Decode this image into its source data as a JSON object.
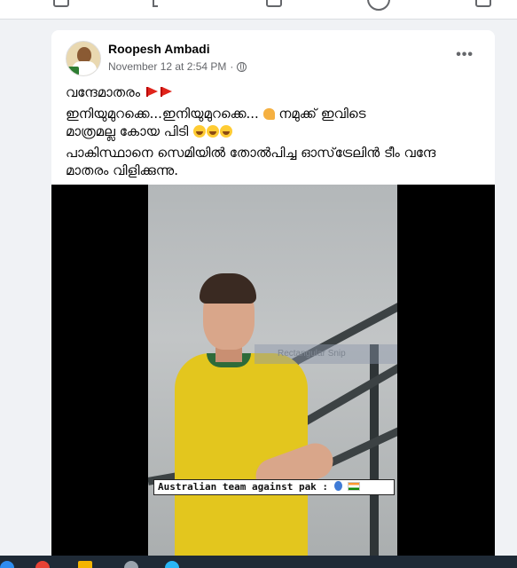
{
  "post": {
    "author": "Roopesh Ambadi",
    "timestamp": "November 12 at 2:54 PM",
    "separator": "·",
    "more_label": "•••",
    "line1": "വന്ദേമാതരം",
    "line2": "ഇനിയുമുറക്കെ...ഇനിയുമുറക്കെ...",
    "line2b": "നമുക്ക് ഇവിടെ",
    "line3": "മാത്രമല്ല കോയ പിടി",
    "line4": "പാകിസ്ഥാനെ സെമിയിൽ തോൽപിച്ച ഓസ്‌ട്രേലിൻ ടീം വന്ദേ മാതരം വിളിക്കുന്നു."
  },
  "media": {
    "snip_label": "Rectangular Snip",
    "caption": "Australian team against pak :"
  },
  "colors": {
    "accent": "#1877f2",
    "shirt": "#e3c61e",
    "background": "#f0f2f5"
  },
  "icons": [
    "globe-icon",
    "more-icon",
    "flag-icon",
    "flexed-biceps-icon",
    "grinning-icon",
    "balloon-icon",
    "india-flag-icon"
  ]
}
